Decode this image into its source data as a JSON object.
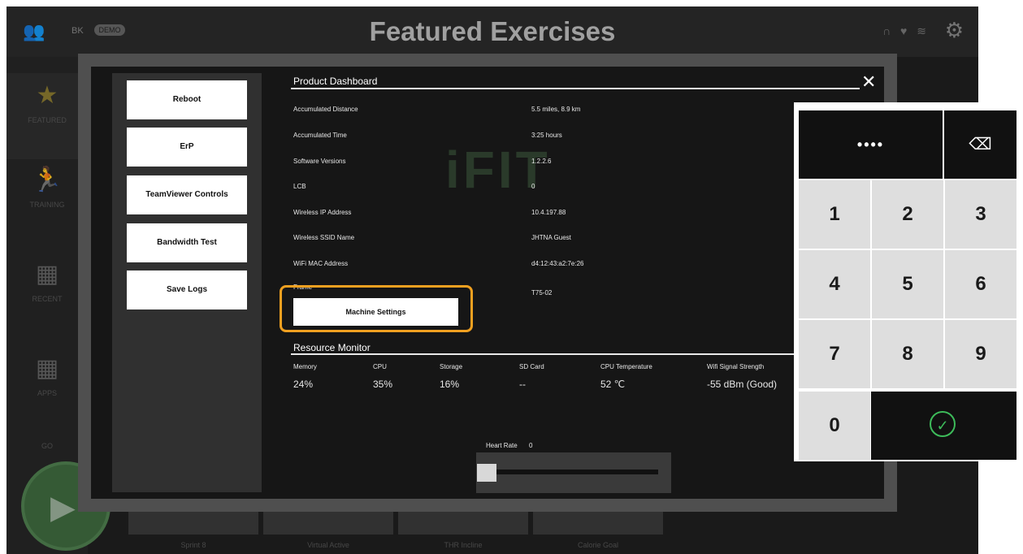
{
  "header": {
    "title": "Featured Exercises",
    "user_code": "BK",
    "demo_badge": "DEMO",
    "status_icons": "∩ ♥ ≋",
    "settings_icon": "gear-icon"
  },
  "sidebar": {
    "items": [
      {
        "label": "FEATURED",
        "icon": "★"
      },
      {
        "label": "TRAINING",
        "icon": "☰"
      },
      {
        "label": "RECENT",
        "icon": "▦"
      },
      {
        "label": "APPS",
        "icon": "▦"
      },
      {
        "label": "GO",
        "icon": ""
      }
    ]
  },
  "background_tiles": [
    {
      "label": "Sprint 8"
    },
    {
      "label": "Virtual Active"
    },
    {
      "label": "THR Incline"
    },
    {
      "label": "Calorie Goal"
    }
  ],
  "modal": {
    "actions": [
      "Reboot",
      "ErP",
      "TeamViewer Controls",
      "Bandwidth Test",
      "Save Logs"
    ],
    "title": "Product Dashboard",
    "close": "✕",
    "watermark": "iFIT",
    "info_rows": [
      {
        "label": "Accumulated Distance",
        "value": "5.5 miles, 8.9 km"
      },
      {
        "label": "Accumulated Time",
        "value": "3:25 hours"
      },
      {
        "label": "Software Versions",
        "value": "1.2.2.6"
      },
      {
        "label": "LCB",
        "value": "0"
      },
      {
        "label": "Wireless IP Address",
        "value": "10.4.197.88"
      },
      {
        "label": "Wireless SSID Name",
        "value": "JHTNA Guest"
      },
      {
        "label": "WiFi MAC Address",
        "value": "d4:12:43:a2:7e:26"
      }
    ],
    "frame": {
      "label": "Frame",
      "value": "T75-02"
    },
    "machine_settings": "Machine Settings",
    "resource_monitor": {
      "title": "Resource Monitor",
      "headers": [
        "Memory",
        "CPU",
        "Storage",
        "SD Card",
        "CPU Temperature",
        "Wifi Signal Strength"
      ],
      "values": [
        "24%",
        "35%",
        "16%",
        "--",
        "52 ℃",
        "-55 dBm (Good)"
      ]
    },
    "heart_rate": {
      "label": "Heart Rate",
      "value": "0"
    }
  },
  "keypad": {
    "display": "••••",
    "backspace": "⌫",
    "keys": [
      "1",
      "2",
      "3",
      "4",
      "5",
      "6",
      "7",
      "8",
      "9",
      "0"
    ],
    "confirm": "✓",
    "accent": "#3dbb5a"
  },
  "colors": {
    "highlight": "#f0a020"
  }
}
